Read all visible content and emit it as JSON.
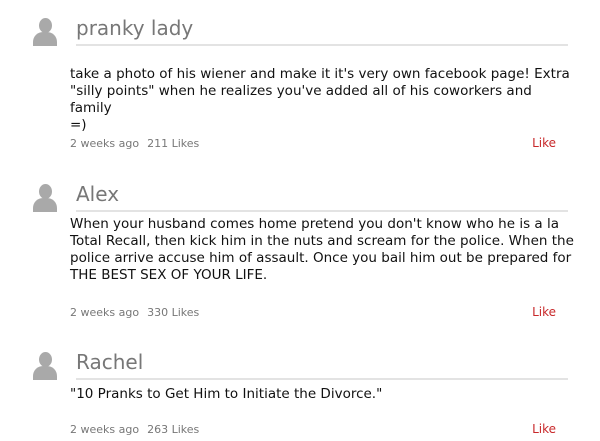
{
  "comments": [
    {
      "name": "pranky lady",
      "body": "take a photo of his wiener and make it it's very own facebook page!  Extra\n\"silly points\" when he realizes you've added all of his coworkers and family\n=)",
      "time": "2 weeks ago",
      "likes": "211 Likes",
      "like_label": "Like"
    },
    {
      "name": "Alex",
      "body": "When your husband comes home pretend you don't know who he is a la\nTotal Recall, then kick him in the nuts and scream for the police. When the\npolice arrive accuse him of assault. Once you bail him out be prepared for\nTHE BEST SEX OF YOUR LIFE.",
      "time": "2 weeks ago",
      "likes": "330 Likes",
      "like_label": "Like"
    },
    {
      "name": "Rachel",
      "body": "\"10 Pranks to Get Him to Initiate the Divorce.\"",
      "time": "2 weeks ago",
      "likes": "263 Likes",
      "like_label": "Like"
    }
  ],
  "colors": {
    "name": "#777777",
    "body": "#111111",
    "meta": "#777777",
    "like": "#c8282a",
    "avatar": "#a9a9a9"
  },
  "icons": {
    "avatar": "user-silhouette-icon"
  }
}
